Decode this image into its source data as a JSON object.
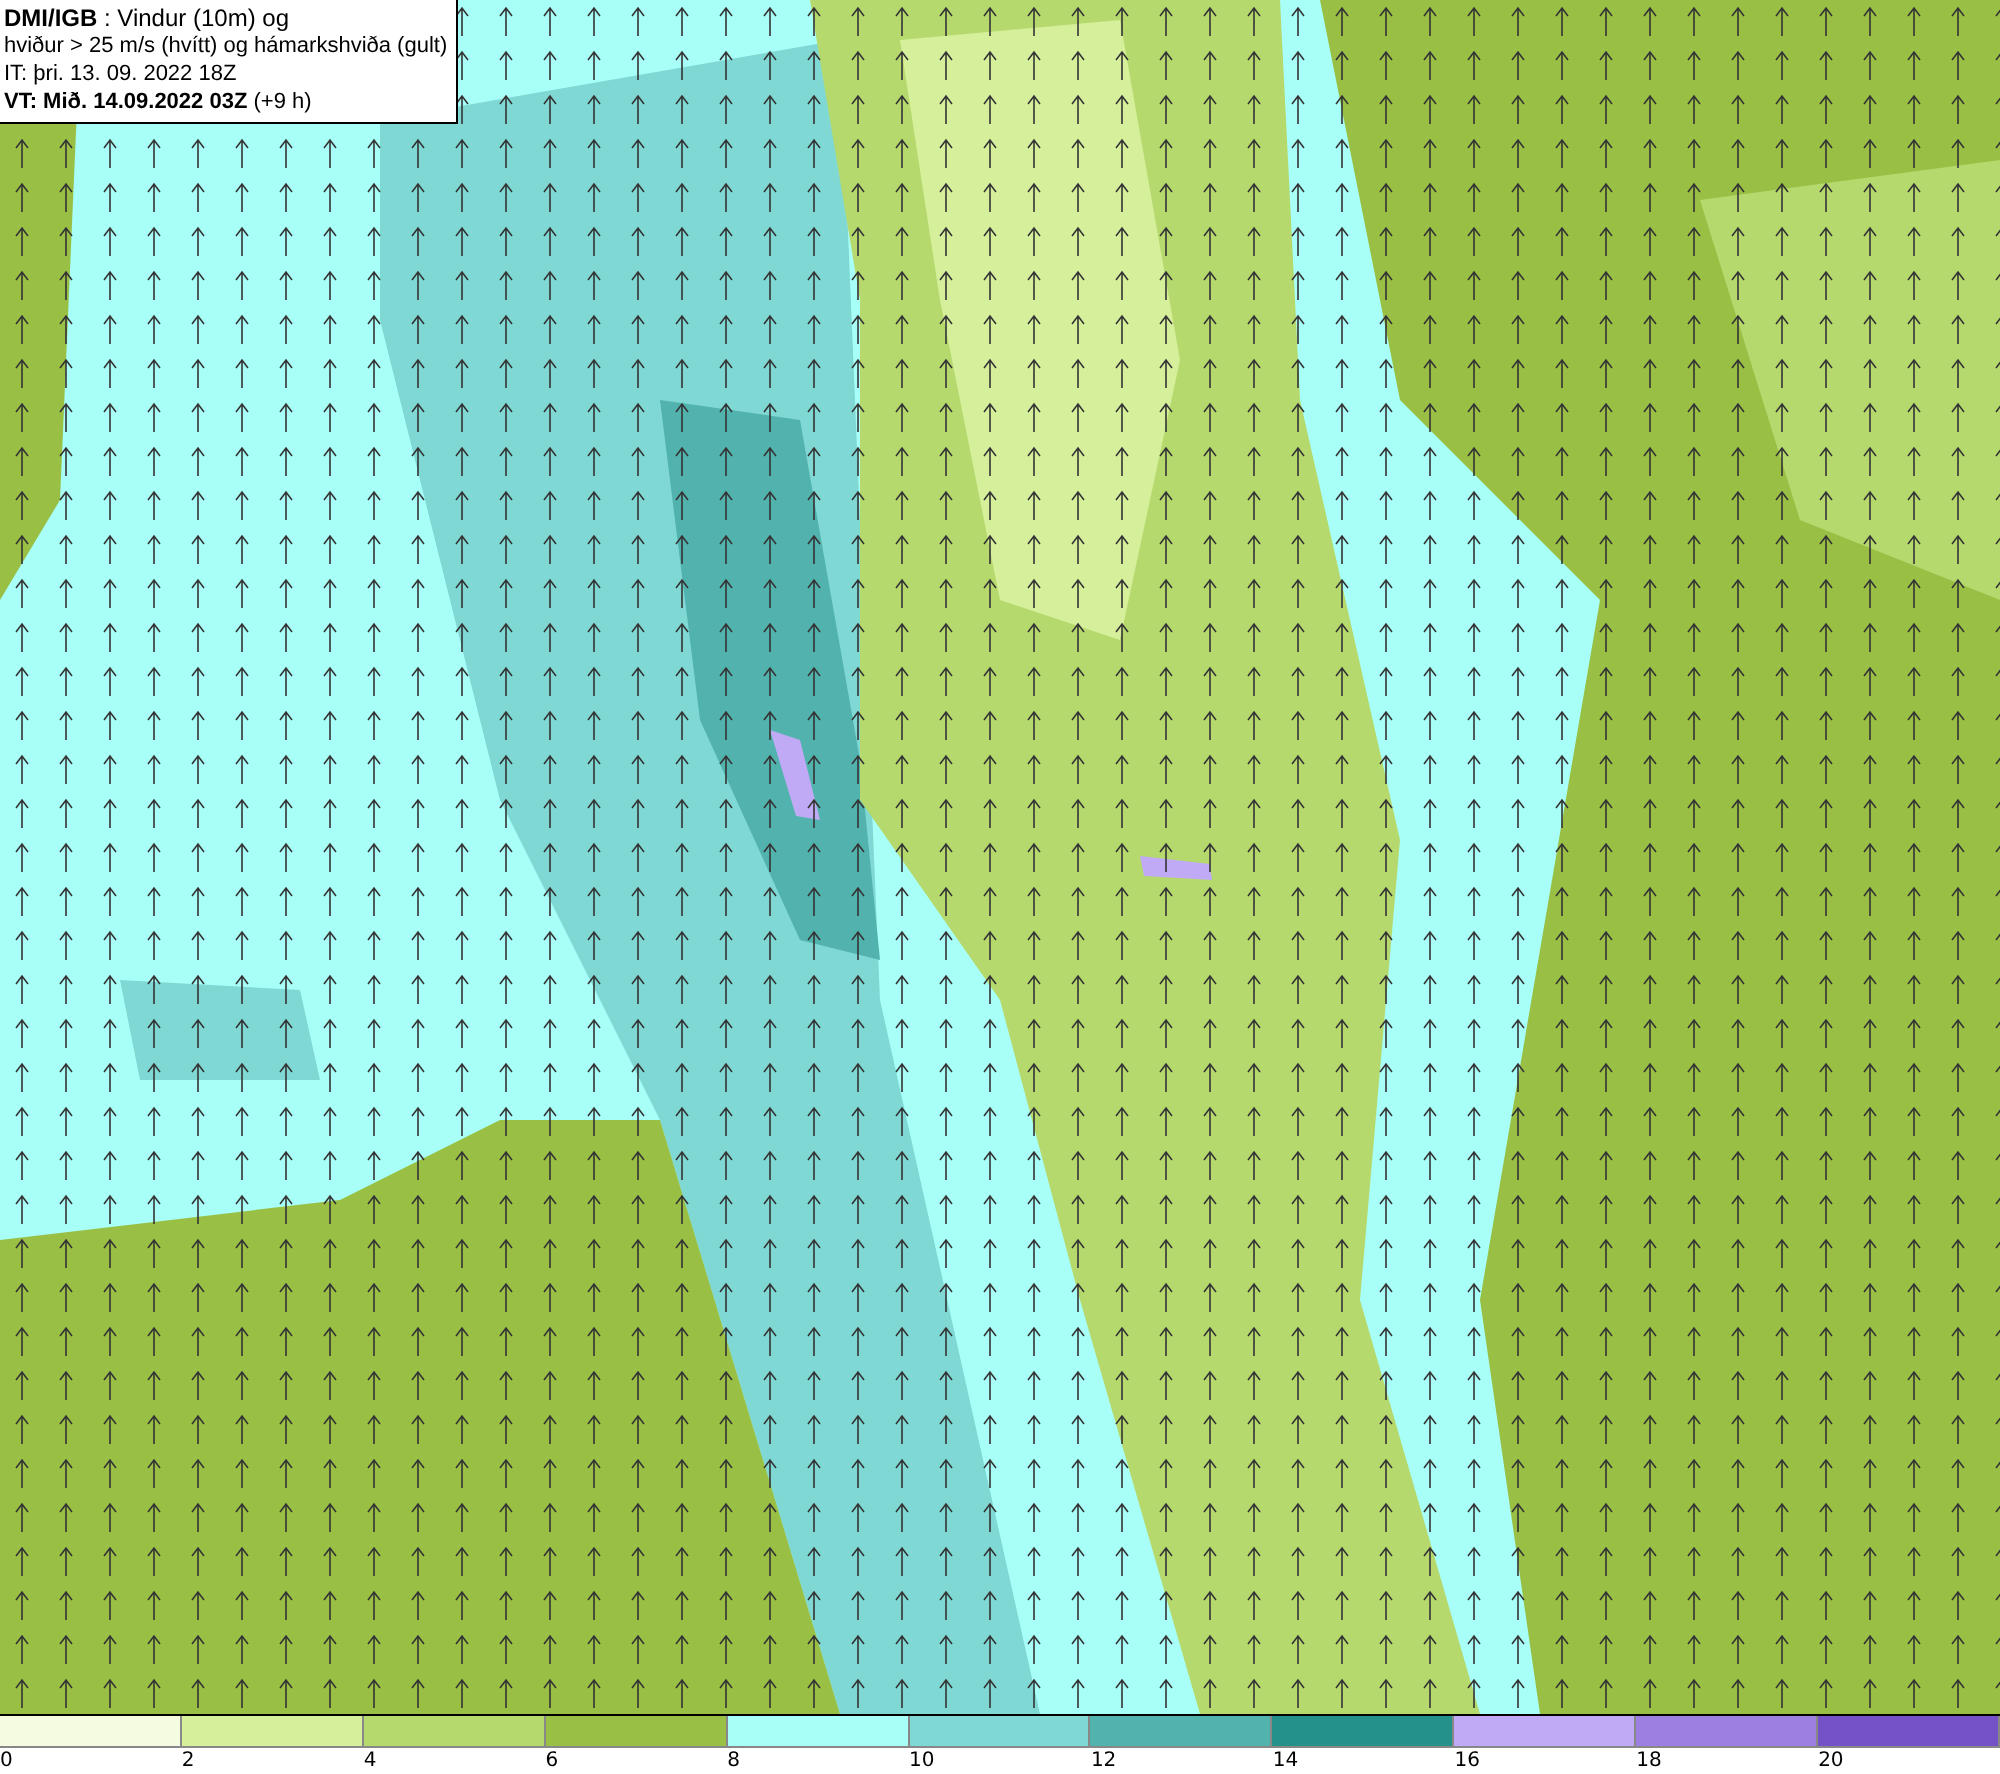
{
  "title_box": {
    "lines": [
      "**DMI/IGB** : Vindur (10m) og",
      "hviður > 25 m/s (hvítt) og hámarkshviða (gult)",
      "IT: þri. 13. 09. 2022 18Z",
      "**VT: Mið. 14.09.2022 03Z** (+9 h)"
    ]
  },
  "legend": {
    "bins": [
      {
        "label": "0",
        "color": "#f5fbe0"
      },
      {
        "label": "2",
        "color": "#d6ef9b"
      },
      {
        "label": "4",
        "color": "#b6d96e"
      },
      {
        "label": "6",
        "color": "#99bf45"
      },
      {
        "label": "8",
        "color": "#a8fff8"
      },
      {
        "label": "10",
        "color": "#7fd8d4"
      },
      {
        "label": "12",
        "color": "#52b2ad"
      },
      {
        "label": "14",
        "color": "#24918b"
      },
      {
        "label": "16",
        "color": "#c0aaf5"
      },
      {
        "label": "18",
        "color": "#9c7fe0"
      },
      {
        "label": "20",
        "color": "#7552c8"
      }
    ]
  }
}
